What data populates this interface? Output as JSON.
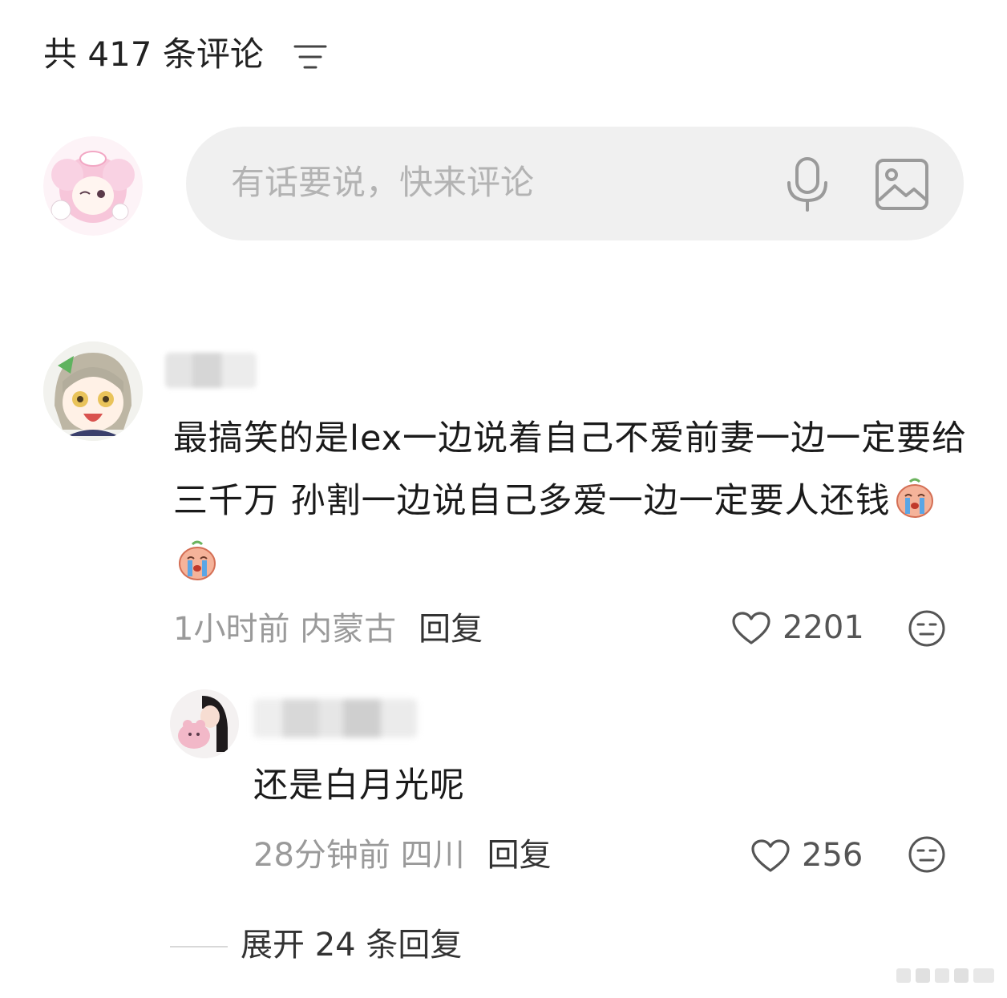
{
  "header": {
    "title": "共 417 条评论",
    "filter_icon": "filter-icon"
  },
  "input": {
    "placeholder": "有话要说，快来评论",
    "mic_icon": "microphone-icon",
    "image_icon": "image-icon"
  },
  "comment": {
    "text": "最搞笑的是lex一边说着自己不爱前妻一边一定要给三千万 孙割一边说自己多爱一边一定要人还钱",
    "emoji": "crying-emoji",
    "time": "1小时前",
    "location": "内蒙古",
    "reply_label": "回复",
    "likes": "2201"
  },
  "reply": {
    "text": "还是白月光呢",
    "time": "28分钟前",
    "location": "四川",
    "reply_label": "回复",
    "likes": "256"
  },
  "expand": {
    "label": "展开 24 条回复"
  },
  "colors": {
    "background": "#ffffff",
    "input_bg": "#f0f0f0",
    "muted_text": "#9a9a9a",
    "primary_text": "#1a1a1a"
  }
}
